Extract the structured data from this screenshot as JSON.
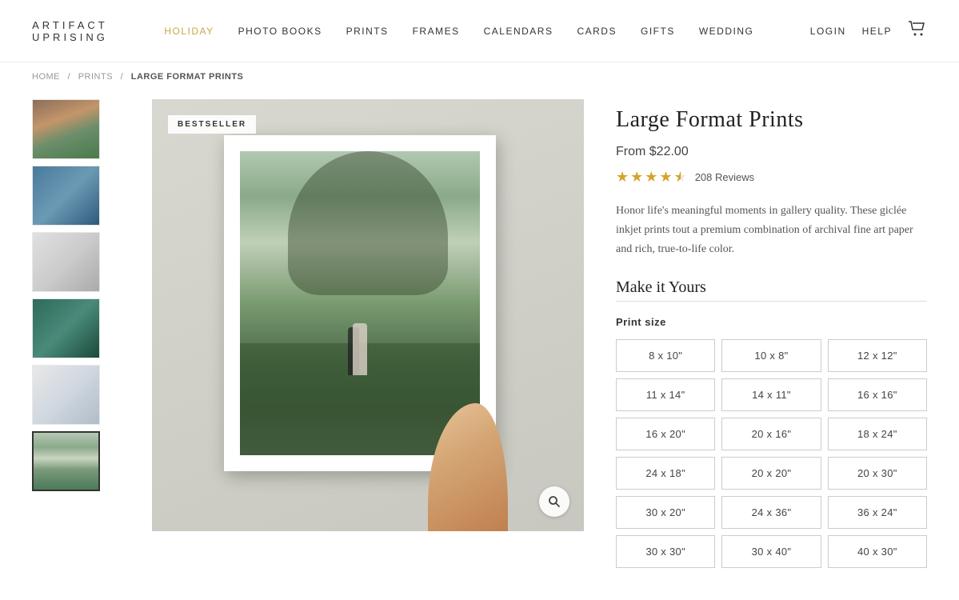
{
  "header": {
    "logo_top": "ARTIFACT",
    "logo_bottom": "UPRISING",
    "nav_items": [
      {
        "label": "HOLIDAY",
        "active": true
      },
      {
        "label": "PHOTO BOOKS"
      },
      {
        "label": "PRINTS"
      },
      {
        "label": "FRAMES"
      },
      {
        "label": "CALENDARS"
      },
      {
        "label": "CARDS"
      },
      {
        "label": "GIFTS"
      },
      {
        "label": "WEDDING"
      }
    ],
    "right_items": [
      {
        "label": "LOGIN"
      },
      {
        "label": "HELP"
      }
    ],
    "cart_icon": "🛒"
  },
  "breadcrumb": {
    "home": "HOME",
    "prints": "PRINTS",
    "current": "LARGE FORMAT PRINTS"
  },
  "product": {
    "title": "Large Format Prints",
    "price": "From $22.00",
    "rating": 4.5,
    "reviews_count": "208 Reviews",
    "description": "Honor life's meaningful moments in gallery quality. These giclée inkjet prints tout a premium combination of archival fine art paper and rich, true-to-life color.",
    "make_it_yours": "Make it Yours",
    "print_size_label": "Print size",
    "bestseller_badge": "BESTSELLER"
  },
  "size_options": [
    {
      "label": "8 x 10\""
    },
    {
      "label": "10 x 8\""
    },
    {
      "label": "12 x 12\""
    },
    {
      "label": "11 x 14\""
    },
    {
      "label": "14 x 11\""
    },
    {
      "label": "16 x 16\""
    },
    {
      "label": "16 x 20\""
    },
    {
      "label": "20 x 16\""
    },
    {
      "label": "18 x 24\""
    },
    {
      "label": "24 x 18\""
    },
    {
      "label": "20 x 20\""
    },
    {
      "label": "20 x 30\""
    },
    {
      "label": "30 x 20\""
    },
    {
      "label": "24 x 36\""
    },
    {
      "label": "36 x 24\""
    },
    {
      "label": "30 x 30\""
    },
    {
      "label": "30 x 40\""
    },
    {
      "label": "40 x 30\""
    }
  ],
  "thumbnails": [
    {
      "id": 1,
      "alt": "Thumbnail 1"
    },
    {
      "id": 2,
      "alt": "Thumbnail 2"
    },
    {
      "id": 3,
      "alt": "Thumbnail 3"
    },
    {
      "id": 4,
      "alt": "Thumbnail 4"
    },
    {
      "id": 5,
      "alt": "Thumbnail 5"
    },
    {
      "id": 6,
      "alt": "Thumbnail 6 - active"
    }
  ],
  "zoom_icon": "🔍"
}
